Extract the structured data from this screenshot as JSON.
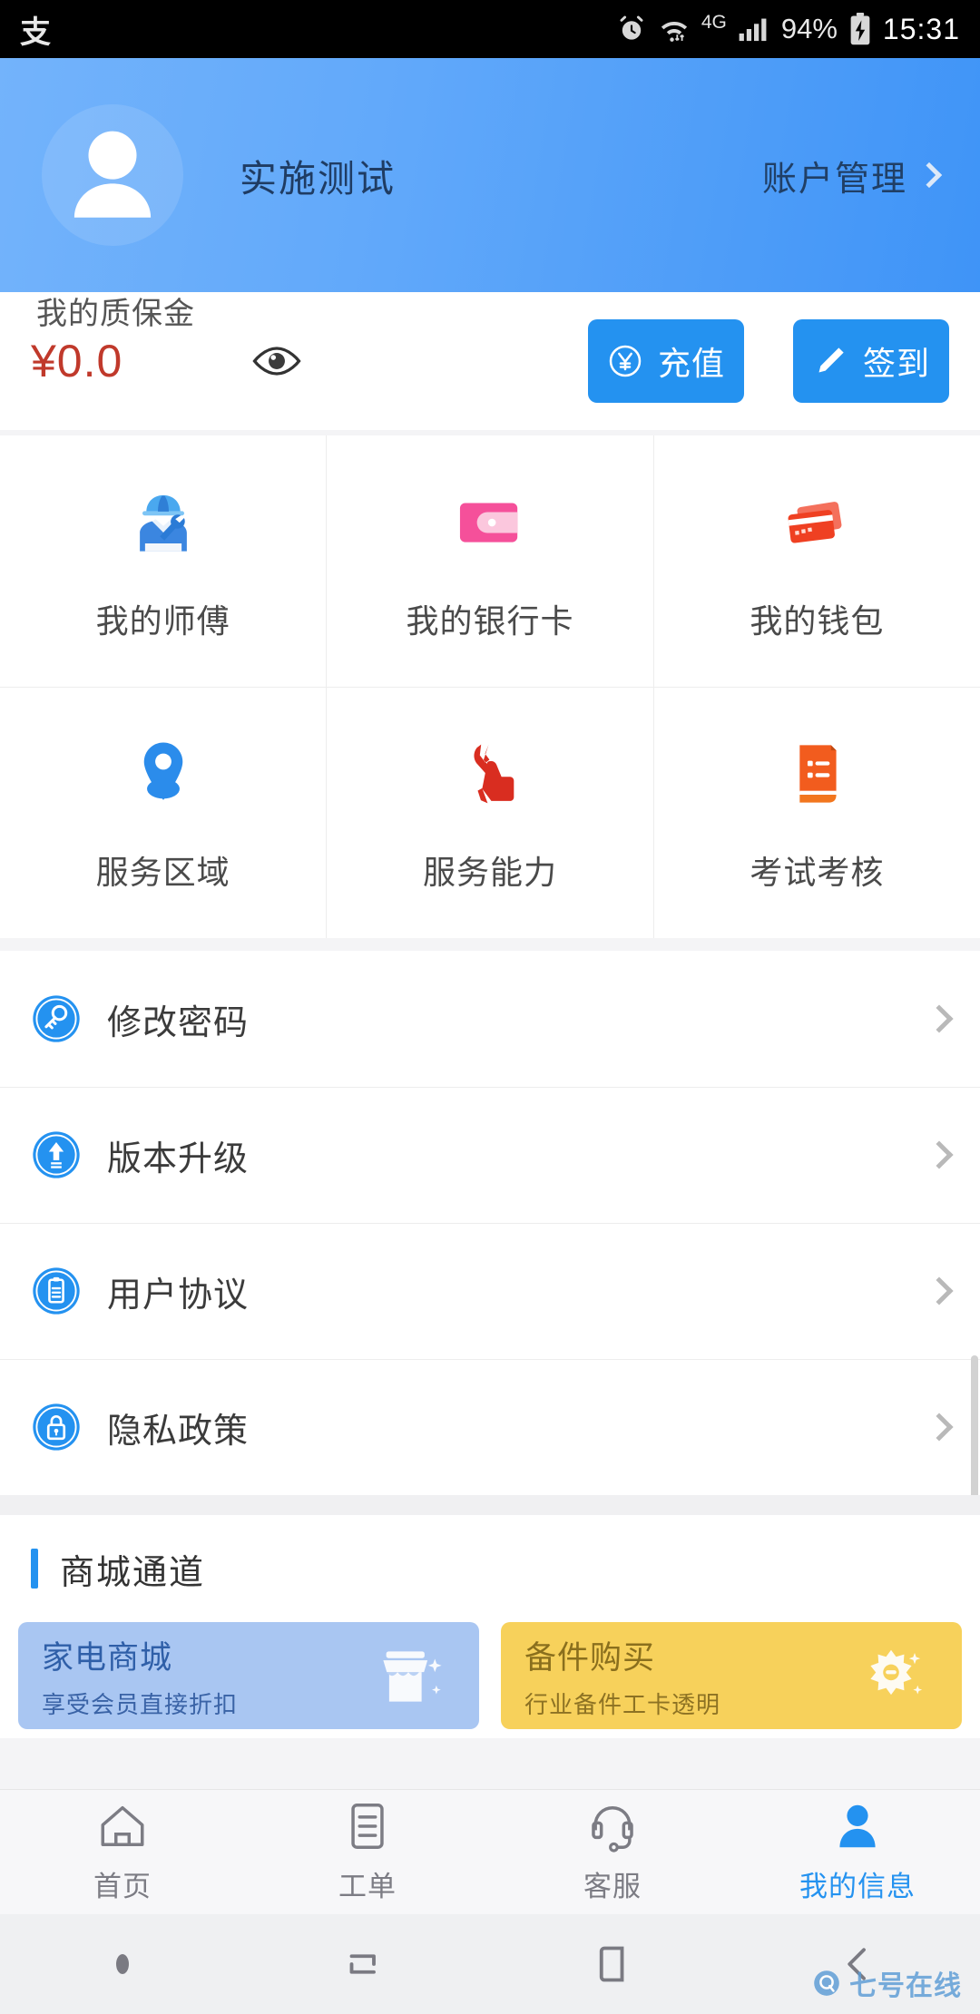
{
  "status_bar": {
    "left_icon": "alipay-icon",
    "alarm_icon": "alarm-icon",
    "wifi_icon": "wifi-icon",
    "network": "4G",
    "signal_icon": "signal-bars-icon",
    "battery_pct": "94%",
    "battery_icon": "battery-charging-icon",
    "time": "15:31"
  },
  "header": {
    "avatar_icon": "avatar-icon",
    "user_name": "实施测试",
    "account_link": "账户管理",
    "chevron_icon": "chevron-right-icon"
  },
  "balance": {
    "label": "我的质保金",
    "amount": "¥0.0",
    "eye_icon": "eye-icon",
    "recharge": {
      "label": "充值",
      "icon": "yuan-circle-icon"
    },
    "signin": {
      "label": "签到",
      "icon": "pencil-icon"
    }
  },
  "grid": [
    [
      {
        "label": "我的师傅",
        "icon": "technician-icon"
      },
      {
        "label": "我的银行卡",
        "icon": "wallet-icon"
      },
      {
        "label": "我的钱包",
        "icon": "bank-cards-icon"
      }
    ],
    [
      {
        "label": "服务区域",
        "icon": "location-pin-icon"
      },
      {
        "label": "服务能力",
        "icon": "wrench-hand-icon"
      },
      {
        "label": "考试考核",
        "icon": "scroll-document-icon"
      }
    ]
  ],
  "settings": [
    {
      "label": "修改密码",
      "icon": "key-icon",
      "chevron": "chevron-right-icon"
    },
    {
      "label": "版本升级",
      "icon": "upgrade-arrow-icon",
      "chevron": "chevron-right-icon"
    },
    {
      "label": "用户协议",
      "icon": "agreement-doc-icon",
      "chevron": "chevron-right-icon"
    },
    {
      "label": "隐私政策",
      "icon": "lock-icon",
      "chevron": "chevron-right-icon"
    }
  ],
  "mall": {
    "section_title": "商城通道",
    "cards": [
      {
        "title": "家电商城",
        "subtitle": "享受会员直接折扣",
        "icon": "storefront-icon",
        "bg_color": "#a9c6f2"
      },
      {
        "title": "备件购买",
        "subtitle": "行业备件工卡透明",
        "icon": "gear-icon",
        "bg_color": "#f7d15b"
      }
    ]
  },
  "tabs": [
    {
      "label": "首页",
      "icon": "home-icon",
      "active": false
    },
    {
      "label": "工单",
      "icon": "workorder-icon",
      "active": false
    },
    {
      "label": "客服",
      "icon": "headset-icon",
      "active": false
    },
    {
      "label": "我的信息",
      "icon": "person-icon",
      "active": true
    }
  ],
  "navbar": {
    "dot_icon": "nav-dot-icon",
    "recents_icon": "recents-icon",
    "home_icon": "home-square-icon",
    "back_icon": "back-arrow-icon"
  },
  "watermark": {
    "text": "七号在线",
    "logo_icon": "q-logo-icon"
  },
  "colors": {
    "accent": "#2492f0",
    "header_gradient_start": "#73b3fb",
    "header_gradient_end": "#3f94f7",
    "amount_red": "#c0392b",
    "tab_active": "#2492f0",
    "tab_inactive": "#7c7c84"
  }
}
